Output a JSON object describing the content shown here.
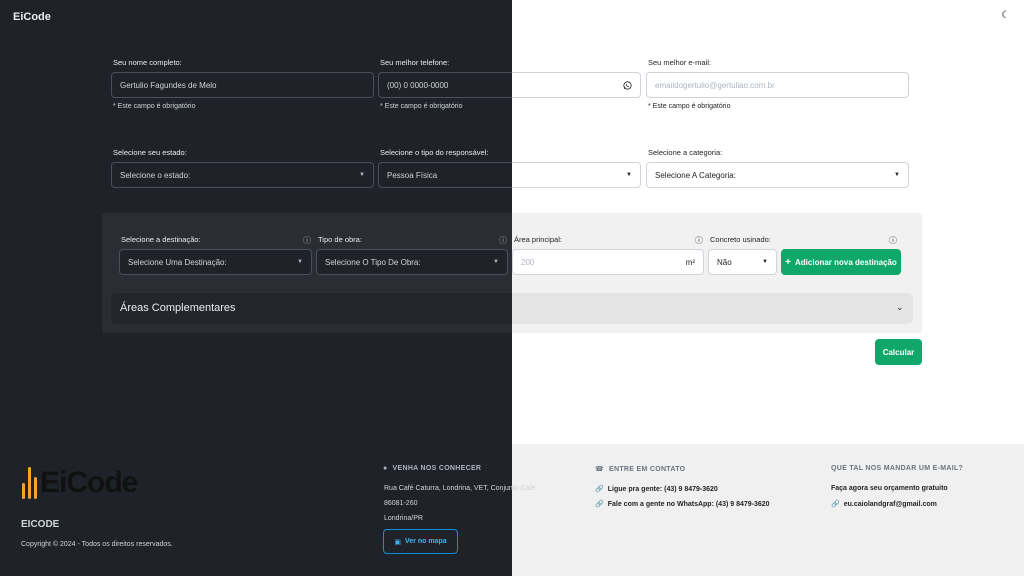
{
  "header": {
    "brand": "EiCode",
    "theme_icon": "moon-icon"
  },
  "form": {
    "name": {
      "label": "Seu nome completo:",
      "value": "Gertulio Fagundes de Melo",
      "help": "* Este campo é obrigatório"
    },
    "phone": {
      "label": "Seu melhor telefone:",
      "value": "(00) 0 0000-0000",
      "help": "* Este campo é obrigatório",
      "icon": "whatsapp-icon"
    },
    "email": {
      "label": "Seu melhor e-mail:",
      "placeholder": "emaildogertulio@gertuliao.com.br",
      "help": "* Este campo é obrigatório"
    },
    "state": {
      "label": "Selecione seu estado:",
      "value": "Selecione o estado:"
    },
    "responsible": {
      "label": "Selecione o tipo do responsável:",
      "value": "Pessoa Física"
    },
    "category": {
      "label": "Selecione a categoria:",
      "value": "Selecione A Categoria:"
    }
  },
  "destination_panel": {
    "destination": {
      "label": "Selecione a destinação:",
      "value": "Selecione Uma Destinação:"
    },
    "work_type": {
      "label": "Tipo de obra:",
      "value": "Selecione O Tipo De Obra:"
    },
    "main_area": {
      "label": "Área principal:",
      "placeholder": "200",
      "unit": "m²"
    },
    "concrete": {
      "label": "Concreto usinado:",
      "value": "Não"
    },
    "add_button": "Adicionar nova destinação",
    "accordion_title": "Áreas Complementares"
  },
  "calculate_button": "Calcular",
  "footer": {
    "logo_text": "EiCode",
    "brand_caption": "EICODE",
    "copyright": "Copyright © 2024 - Todos os direitos reservados.",
    "visit": {
      "title": "VENHA NOS CONHECER",
      "address1": "Rua Café Caturra, Londrina, VET, Conjunto Café",
      "zip": "86081-260",
      "city": "Londrina/PR",
      "map_button": "Ver no mapa"
    },
    "contact": {
      "title": "ENTRE EM CONTATO",
      "phone": "Ligue pra gente: (43) 9 8479-3620",
      "whatsapp": "Fale com a gente no WhatsApp: (43) 9 8479-3620"
    },
    "email": {
      "title": "QUE TAL NOS MANDAR UM E-MAIL?",
      "subtitle": "Faça agora seu orçamento gratuito",
      "address": "eu.caiolandgraf@gmail.com"
    }
  },
  "colors": {
    "accent": "#0fa86a",
    "dark_bg": "#1f2329",
    "logo_orange": "#f5a623",
    "map_button_border": "#0d8fd6"
  }
}
